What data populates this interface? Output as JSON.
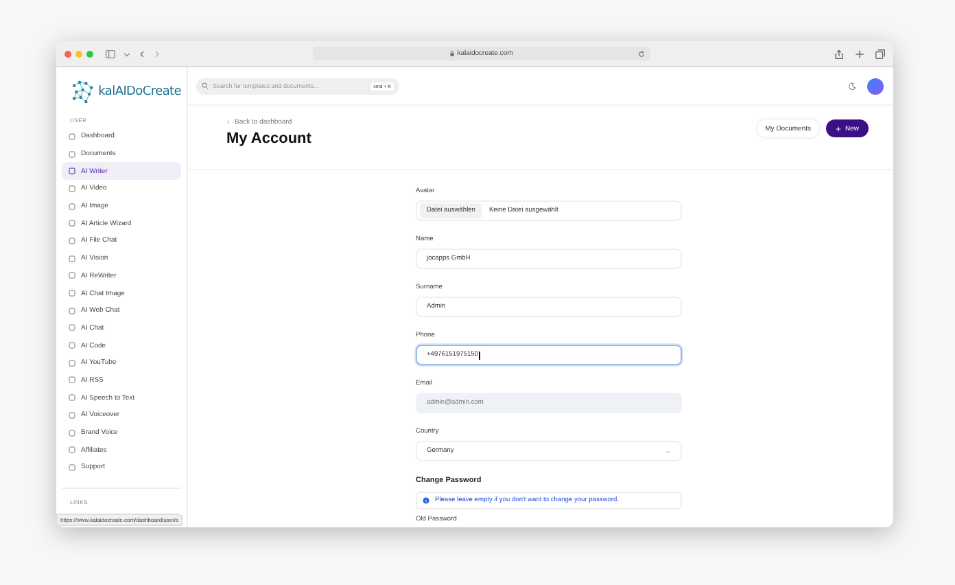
{
  "browser": {
    "address": "kalaidocreate.com",
    "status_url": "https://www.kalaidocreate.com/dashboard/user/s"
  },
  "logo": {
    "text": "kalAIDoCreate"
  },
  "search": {
    "placeholder": "Search for templates and documents...",
    "shortcut": "cmd + K"
  },
  "sidebar": {
    "section": "USER",
    "items": [
      {
        "label": "Dashboard",
        "selected": false
      },
      {
        "label": "Documents",
        "selected": false
      },
      {
        "label": "AI Writer",
        "selected": true
      },
      {
        "label": "AI Video",
        "selected": false
      },
      {
        "label": "AI Image",
        "selected": false
      },
      {
        "label": "AI Article Wizard",
        "selected": false
      },
      {
        "label": "AI File Chat",
        "selected": false
      },
      {
        "label": "AI Vision",
        "selected": false
      },
      {
        "label": "AI ReWriter",
        "selected": false
      },
      {
        "label": "AI Chat Image",
        "selected": false
      },
      {
        "label": "AI Web Chat",
        "selected": false
      },
      {
        "label": "AI Chat",
        "selected": false
      },
      {
        "label": "AI Code",
        "selected": false
      },
      {
        "label": "AI YouTube",
        "selected": false
      },
      {
        "label": "AI RSS",
        "selected": false
      },
      {
        "label": "AI Speech to Text",
        "selected": false
      },
      {
        "label": "AI Voiceover",
        "selected": false
      },
      {
        "label": "Brand Voice",
        "selected": false
      },
      {
        "label": "Affiliates",
        "selected": false
      },
      {
        "label": "Support",
        "selected": false
      }
    ],
    "links_section": "LINKS"
  },
  "header": {
    "back": "Back to dashboard",
    "title": "My Account",
    "buttons": [
      {
        "label": "My Documents",
        "kind": "secondary"
      },
      {
        "label": "New",
        "kind": "primary"
      }
    ]
  },
  "form": {
    "fields": [
      {
        "label": "Avatar",
        "kind": "file",
        "button": "Datei auswählen",
        "value": "Keine Datei ausgewählt"
      },
      {
        "label": "Name",
        "kind": "text",
        "value": "jocapps GmbH",
        "focused": false
      },
      {
        "label": "Surname",
        "kind": "text",
        "value": "Admin",
        "focused": false
      },
      {
        "label": "Phone",
        "kind": "text",
        "value": "+4976151975150",
        "focused": true
      },
      {
        "label": "Email",
        "kind": "disabled",
        "placeholder": "admin@admin.com"
      },
      {
        "label": "Country",
        "kind": "select",
        "value": "Germany"
      }
    ],
    "password_heading": "Change Password",
    "info": "Please leave empty if you don't want to change your password.",
    "next_label": "Old Password"
  }
}
